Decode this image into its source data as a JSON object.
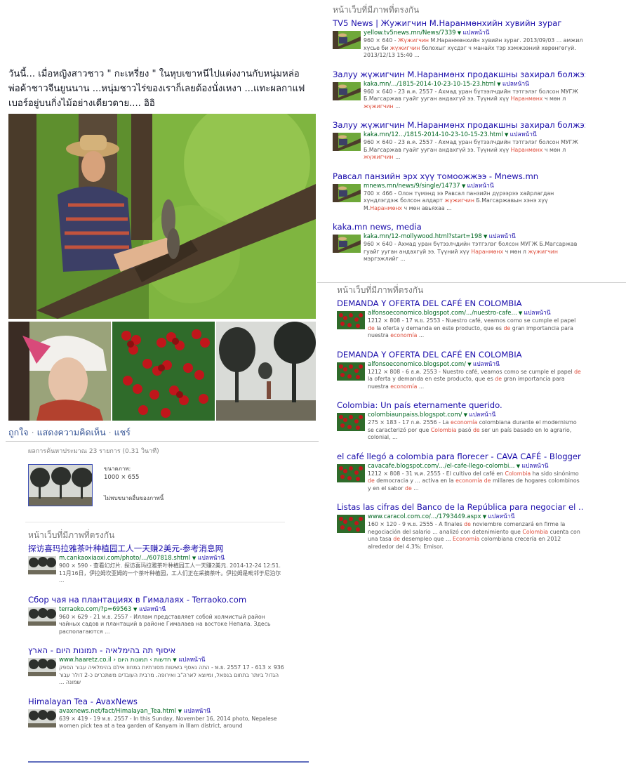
{
  "post": {
    "text": "วันนี้... เมื่อหญิงสาวชาว \" กะเหรี่ยง \" ในหุบเขาหนีไปแต่งงานกับหนุ่มหล่อพ่อค้าชาวจีนยูนนาน ...หนุ่มชาวไร่ของเราก็เลยต้องนั่งเหงา ...แทะผลกาแฟเบอร์อยู่บนกิ่งไม้อย่างเดียวดาย.... อิอิ",
    "actions": [
      "ถูกใจ",
      "แสดงความคิดเห็น",
      "แชร์"
    ]
  },
  "image_info": {
    "result_count": "ผลการค้นหาประมาณ 23 รายการ (0.31 วินาที)",
    "size_label": "ขนาดภาพ:",
    "size_value": "1000 × 655",
    "no_other_sizes": "ไม่พบขนาดอื่นของภาพนี้"
  },
  "section_title": "หน้าเว็บที่มีภาพที่ตรงกัน",
  "similar_label": "แปลหน้านี้",
  "left_results": [
    {
      "title": "探访喜玛拉雅茶叶种植园工人一天赚2美元-参考消息网",
      "url": "m.cankaoxiaoxi.com/photo/.../607818.shtml",
      "meta": "900 × 590 - 查看幻灯片. 探访喜玛拉雅茶叶种植园工人一天赚2美元. 2014-12-24 12:51. 11月16日，伊拉姆坎亚姆的一个茶叶种植园，工人们正在采摘茶叶。伊拉姆是毗邻于尼泊尔 ..."
    },
    {
      "title": "Сбор чая на плантациях в Гималаях - Terraoko.com",
      "url": "terraoko.com/?p=69563",
      "meta": "960 × 629 - 21 พ.ย. 2557 - Иллам представляет собой холмистый район чайных садов и плантаций в районе Гималаев на востоке Непала. Здесь располагаются ..."
    },
    {
      "title": "איסוף תה בהימלאיה - תמונות היום - הארץ",
      "url": "www.haaretz.co.il › חדשות › תמונות היום",
      "meta": "936 × 613 - 17 พ.ย. 2557 - התה נאסף בשיטות מסורתיות במחוז אילם בהימלאיה עבור הספק הגדול ביותר בתחום בנפאל, ומיוצא לארה\"ב ואירופה. מרבית העובדים משתכרים כ-2 דולר עבור שמונה ..."
    },
    {
      "title": "Himalayan Tea - AvaxNews",
      "url": "avaxnews.net/fact/Himalayan_Tea.html",
      "meta": "639 × 419 - 19 พ.ย. 2557 - In this Sunday, November 16, 2014 photo, Nepalese women pick tea at a tea garden of Kanyam in Illam district, around"
    }
  ],
  "right_top_results": [
    {
      "title": "TV5 News | Жужигчин М.Наранмөнхийн хувийн зураг",
      "url": "yellow.tv5news.mn/News/7339",
      "meta_parts": [
        [
          "960 × 640 - ",
          false
        ],
        [
          "Жүжигчин",
          true
        ],
        [
          " М.Наранмөнхийн хувийн зураг. 2013/09/03 ... амжил хүсье би ",
          false
        ],
        [
          "жүжигчин",
          true
        ],
        [
          " болохыг хүсдэг ч манайх тэр хэмжээний хөрөнгөгүй. 2013/12/13 15:40 ...",
          false
        ]
      ]
    },
    {
      "title": "Залуу жүжигчин М.Наранмөнх продакшны захирал болжээ",
      "url": "kaka.mn/.../1815-2014-10-23-10-15-23.html",
      "meta_parts": [
        [
          "960 × 640 - 23 ต.ค. 2557 - Ахмад уран бүтээлчдийн тэтгэлэг болсон МУГЖ Б.Магсаржав гуайг ууган андахгүй ээ. Түүний хүү ",
          false
        ],
        [
          "Наранмөнх",
          true
        ],
        [
          " ч мөн л ",
          false
        ],
        [
          "жүжигчин",
          true
        ],
        [
          " ...",
          false
        ]
      ]
    },
    {
      "title": "Залуу жүжигчин М.Наранмөнх продакшны захирал болжээ",
      "url": "kaka.mn/12.../1815-2014-10-23-10-15-23.html",
      "meta_parts": [
        [
          "960 × 640 - 23 ต.ค. 2557 - Ахмад уран бүтээлчдийн тэтгэлэг болсон МУГЖ Б.Магсаржав гуайг ууган андахгүй ээ. Түүний хүү ",
          false
        ],
        [
          "Наранмөнх",
          true
        ],
        [
          " ч мөн л ",
          false
        ],
        [
          "жүжигчин",
          true
        ],
        [
          " ...",
          false
        ]
      ]
    },
    {
      "title": "Равсал панзийн эрх хүү томоожжээ - Mnews.mn",
      "url": "mnews.mn/news/9/single/14737",
      "meta_parts": [
        [
          "700 × 466 - Олон түмэнд ээ Равсал панзийн дүрээрээ хайрлагдан хүндлэгдэж болсон алдарт ",
          false
        ],
        [
          "жүжигчин",
          true
        ],
        [
          " Б.Магсаржавын хэнэ хүү М.",
          false
        ],
        [
          "Наранмөнх",
          true
        ],
        [
          " ч мөн авьяхаа ...",
          false
        ]
      ]
    },
    {
      "title": "kaka.mn news, media",
      "url": "kaka.mn/12-mollywood.html?start=198",
      "meta_parts": [
        [
          "960 × 640 - Ахмад уран бүтээлчдийн тэтгэлэг болсон МУГЖ Б.Магсаржав гуайг ууган андахгүй ээ. Түүний хүү ",
          false
        ],
        [
          "Наранмөнх",
          true
        ],
        [
          " ч мөн л ",
          false
        ],
        [
          "жүжигчин",
          true
        ],
        [
          " мэргэжлийг ...",
          false
        ]
      ]
    }
  ],
  "right_bottom_results": [
    {
      "title": "DEMANDA Y OFERTA DEL CAFÉ EN COLOMBIA",
      "url": "alfonsoeconomico.blogspot.com/.../nuestro-cafe...",
      "meta_parts": [
        [
          "1212 × 808 - 17 พ.ย. 2553 - Nuestro café, veamos como se cumple el papel ",
          false
        ],
        [
          "de",
          true
        ],
        [
          " la oferta y demanda en este producto, que es ",
          false
        ],
        [
          "de",
          true
        ],
        [
          " gran importancia para nuestra ",
          false
        ],
        [
          "economía",
          true
        ],
        [
          " ...",
          false
        ]
      ]
    },
    {
      "title": "DEMANDA Y OFERTA DEL CAFÉ EN COLOMBIA",
      "url": "alfonsoeconomico.blogspot.com/",
      "meta_parts": [
        [
          "1212 × 808 - 6 ธ.ค. 2553 - Nuestro café, veamos como se cumple el papel ",
          false
        ],
        [
          "de",
          true
        ],
        [
          " la oferta y demanda en este producto, que es ",
          false
        ],
        [
          "de",
          true
        ],
        [
          " gran importancia para nuestra ",
          false
        ],
        [
          "economía",
          true
        ],
        [
          " ...",
          false
        ]
      ]
    },
    {
      "title": "Colombia: Un país eternamente querido.",
      "url": "colombiaunpaiss.blogspot.com/",
      "meta_parts": [
        [
          "275 × 183 - 17 ก.ค. 2556 - La ",
          false
        ],
        [
          "economía",
          true
        ],
        [
          " colombiana durante el modernismo se caracterizó por que ",
          false
        ],
        [
          "Colombia",
          true
        ],
        [
          " pasó ",
          false
        ],
        [
          "de",
          true
        ],
        [
          " ser un país basado en lo agrario, colonial, ...",
          false
        ]
      ]
    },
    {
      "title": "el café llegó a colombia para florecer - CAVA CAFÉ - Blogger",
      "url": "cavacafe.blogspot.com/.../el-cafe-llego-colombi...",
      "meta_parts": [
        [
          "1212 × 808 - 31 พ.ค. 2555 - El cultivo del café en ",
          false
        ],
        [
          "Colombia",
          true
        ],
        [
          " ha sido sinónimo ",
          false
        ],
        [
          "de",
          true
        ],
        [
          " democracia y ... activa en la ",
          false
        ],
        [
          "economía",
          true
        ],
        [
          " ",
          false
        ],
        [
          "de",
          true
        ],
        [
          " millares de hogares colombinos y en el sabor ",
          false
        ],
        [
          "de",
          true
        ],
        [
          " ...",
          false
        ]
      ]
    },
    {
      "title": "Listas las cifras del Banco de la República para negociar el ...",
      "url": "www.caracol.com.co/.../1793449.aspx",
      "meta_parts": [
        [
          "160 × 120 - 9 พ.ย. 2555 - A finales ",
          false
        ],
        [
          "de",
          true
        ],
        [
          " noviembre comenzará en firme la negociación del salario ... analizó con detenimiento que ",
          false
        ],
        [
          "Colombia",
          true
        ],
        [
          " cuenta con una tasa ",
          false
        ],
        [
          "de",
          true
        ],
        [
          " desempleo que ... ",
          false
        ],
        [
          "Economía",
          true
        ],
        [
          " colombiana crecería en 2012 alrededor del 4.3%: Emisor.",
          false
        ]
      ]
    }
  ],
  "colors": {
    "link": "#1a0dab",
    "url": "#006621",
    "highlight": "#dd4b39",
    "fb_link": "#3b5998"
  }
}
